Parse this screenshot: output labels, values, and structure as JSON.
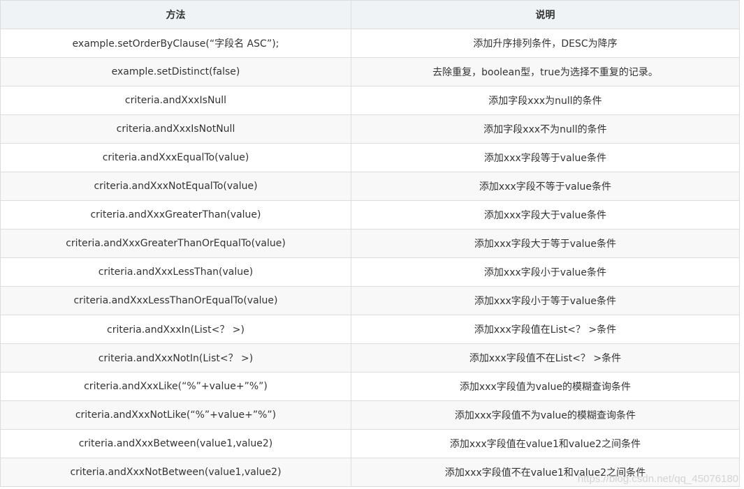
{
  "table": {
    "headers": [
      "方法",
      "说明"
    ],
    "rows": [
      [
        "example.setOrderByClause(“字段名 ASC”);",
        "添加升序排列条件，DESC为降序"
      ],
      [
        "example.setDistinct(false)",
        "去除重复，boolean型，true为选择不重复的记录。"
      ],
      [
        "criteria.andXxxIsNull",
        "添加字段xxx为null的条件"
      ],
      [
        "criteria.andXxxIsNotNull",
        "添加字段xxx不为null的条件"
      ],
      [
        "criteria.andXxxEqualTo(value)",
        "添加xxx字段等于value条件"
      ],
      [
        "criteria.andXxxNotEqualTo(value)",
        "添加xxx字段不等于value条件"
      ],
      [
        "criteria.andXxxGreaterThan(value)",
        "添加xxx字段大于value条件"
      ],
      [
        "criteria.andXxxGreaterThanOrEqualTo(value)",
        "添加xxx字段大于等于value条件"
      ],
      [
        "criteria.andXxxLessThan(value)",
        "添加xxx字段小于value条件"
      ],
      [
        "criteria.andXxxLessThanOrEqualTo(value)",
        "添加xxx字段小于等于value条件"
      ],
      [
        "criteria.andXxxIn(List<？ >)",
        "添加xxx字段值在List<？ >条件"
      ],
      [
        "criteria.andXxxNotIn(List<？ >)",
        "添加xxx字段值不在List<？ >条件"
      ],
      [
        "criteria.andXxxLike(“%”+value+”%”)",
        "添加xxx字段值为value的模糊查询条件"
      ],
      [
        "criteria.andXxxNotLike(“%”+value+”%”)",
        "添加xxx字段值不为value的模糊查询条件"
      ],
      [
        "criteria.andXxxBetween(value1,value2)",
        "添加xxx字段值在value1和value2之间条件"
      ],
      [
        "criteria.andXxxNotBetween(value1,value2)",
        "添加xxx字段值不在value1和value2之间条件"
      ]
    ]
  },
  "watermark": "https://blog.csdn.net/qq_45076180"
}
